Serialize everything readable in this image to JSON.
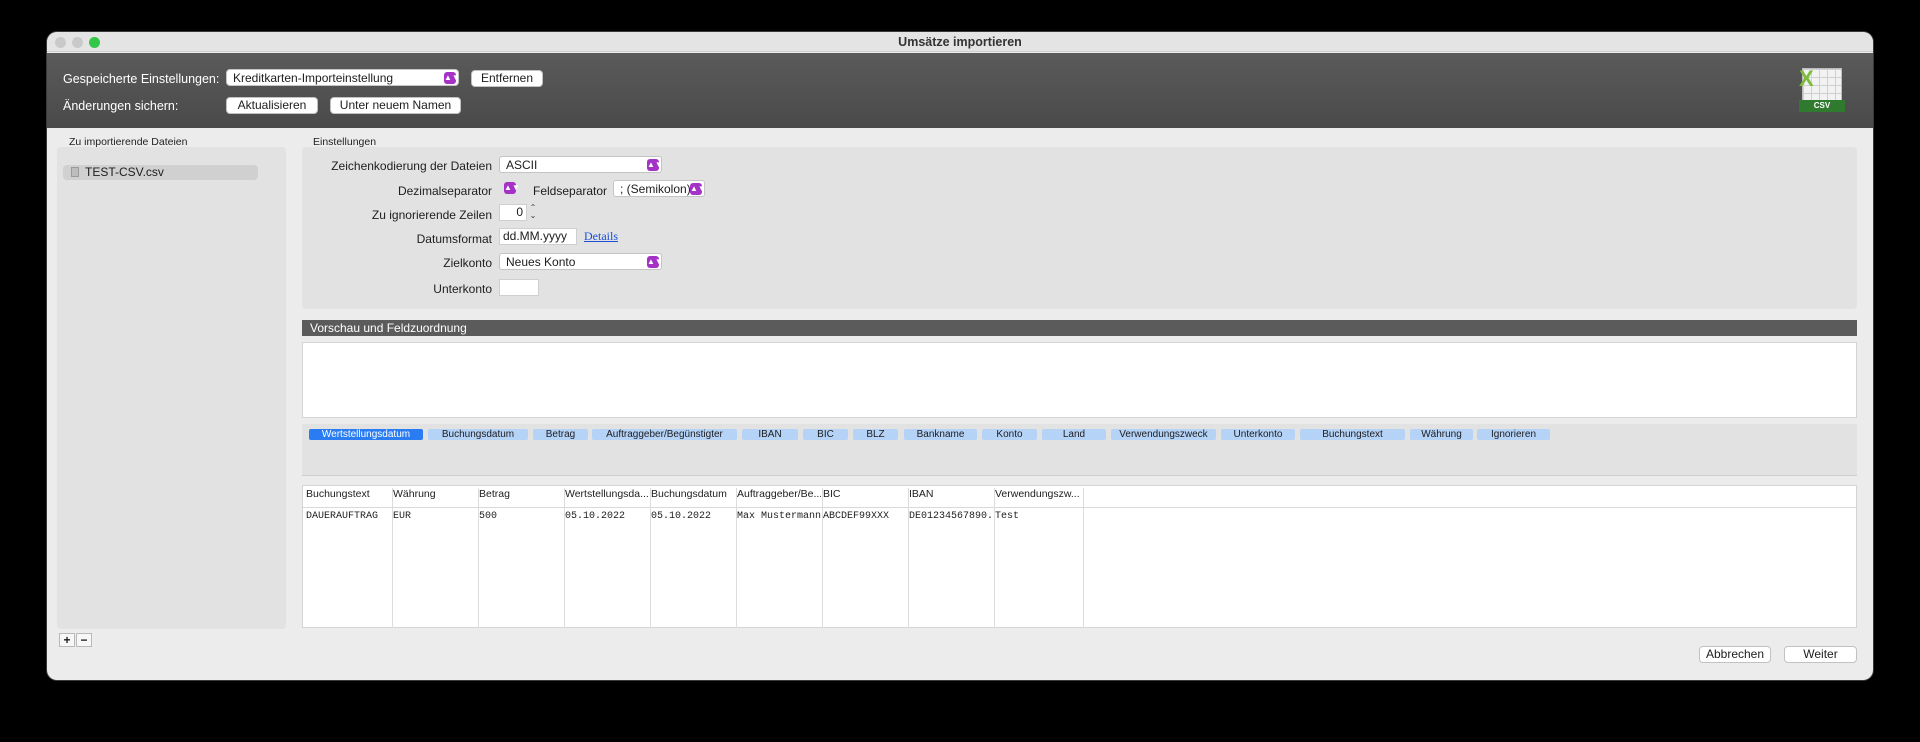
{
  "window": {
    "title": "Umsätze importieren"
  },
  "header": {
    "saved_settings_label": "Gespeicherte Einstellungen:",
    "saved_settings_value": "Kreditkarten-Importeinstellung",
    "remove_label": "Entfernen",
    "save_changes_label": "Änderungen sichern:",
    "update_label": "Aktualisieren",
    "save_as_label": "Unter neuem Namen",
    "csv_icon_text": "CSV"
  },
  "files": {
    "section_label": "Zu importierende Dateien",
    "items": [
      "TEST-CSV.csv"
    ],
    "add_label": "+",
    "remove_label": "−"
  },
  "settings": {
    "section_label": "Einstellungen",
    "encoding_label": "Zeichenkodierung der Dateien",
    "encoding_value": "ASCII",
    "decimal_label": "Dezimalseparator",
    "decimal_value": "",
    "field_sep_label": "Feldseparator",
    "field_sep_value": "; (Semikolon)",
    "ignore_rows_label": "Zu ignorierende Zeilen",
    "ignore_rows_value": "0",
    "date_format_label": "Datumsformat",
    "date_format_value": "dd.MM.yyyy",
    "details_link": "Details",
    "target_account_label": "Zielkonto",
    "target_account_value": "Neues Konto",
    "subaccount_label": "Unterkonto",
    "subaccount_value": ""
  },
  "preview": {
    "header": "Vorschau und Feldzuordnung",
    "tags": [
      "Wertstellungsdatum",
      "Buchungsdatum",
      "Betrag",
      "Auftraggeber/Begünstigter",
      "IBAN",
      "BIC",
      "BLZ",
      "Bankname",
      "Konto",
      "Land",
      "Verwendungszweck",
      "Unterkonto",
      "Buchungstext",
      "Währung",
      "Ignorieren"
    ],
    "active_tag": "Wertstellungsdatum",
    "columns": [
      "Buchungstext",
      "Währung",
      "Betrag",
      "Wertstellungsda...",
      "Buchungsdatum",
      "Auftraggeber/Be...",
      "BIC",
      "IBAN",
      "Verwendungszw..."
    ],
    "rows": [
      [
        "DAUERAUFTRAG",
        "EUR",
        "500",
        "05.10.2022",
        "05.10.2022",
        "Max Mustermann",
        "ABCDEF99XXX",
        "DE01234567890...",
        "Test"
      ]
    ]
  },
  "footer": {
    "cancel_label": "Abbrechen",
    "next_label": "Weiter"
  },
  "colors": {
    "accent": "#a532c7",
    "active_tag": "#2a7cf2",
    "tag": "#b5d3f7",
    "header_bg": "#4f4f4f",
    "zoom": "#33c748"
  }
}
